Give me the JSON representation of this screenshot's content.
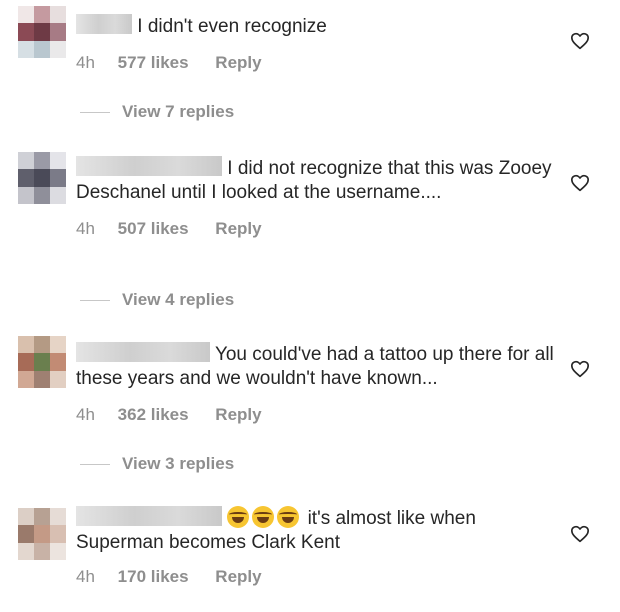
{
  "comments": [
    {
      "text": "I didn't even recognize",
      "time": "4h",
      "likes": "577 likes",
      "reply": "Reply",
      "view_replies": "View 7 replies"
    },
    {
      "text": "I did not recognize that this was Zooey Deschanel until I looked at the username....",
      "time": "4h",
      "likes": "507 likes",
      "reply": "Reply",
      "view_replies": "View 4 replies"
    },
    {
      "text": "You could've had a tattoo up there for all these years and we wouldn't have known...",
      "time": "4h",
      "likes": "362 likes",
      "reply": "Reply",
      "view_replies": "View 3 replies"
    },
    {
      "text": "it's almost like when Superman becomes Clark Kent",
      "time": "4h",
      "likes": "170 likes",
      "reply": "Reply"
    }
  ],
  "colors": {
    "text": "#262626",
    "muted": "#8e8e8e",
    "divider": "#c7c7c7"
  },
  "icons": {
    "like": "heart-icon",
    "emoji": "face-with-tears-of-joy-icon"
  }
}
